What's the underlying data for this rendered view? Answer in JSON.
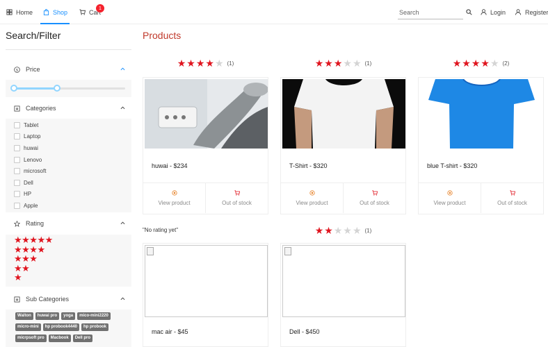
{
  "nav": {
    "home": "Home",
    "shop": "Shop",
    "cart": "Cart",
    "cart_count": "1",
    "search_placeholder": "Search",
    "login": "Login",
    "register": "Register"
  },
  "sidebar": {
    "title": "Search/Filter",
    "price_label": "Price",
    "price_range": {
      "low": 0,
      "high": 0.39
    },
    "categories_label": "Categories",
    "categories": [
      "Tablet",
      "Laptop",
      "huwai",
      "Lenovo",
      "microsoft",
      "Dell",
      "HP",
      "Apple"
    ],
    "rating_label": "Rating",
    "rating_options": [
      "★★★★★",
      "★★★★",
      "★★★",
      "★★",
      "★"
    ],
    "subcategories_label": "Sub Categories",
    "subcategories": [
      "Walton",
      "huwai pro",
      "yoga",
      "mico-mini2220",
      "micro-mini",
      "hp probook4440",
      "hp probook",
      "micrpsoft pro",
      "Macbook",
      "Dell pro"
    ]
  },
  "main": {
    "title": "Products",
    "products": [
      {
        "rating": 4,
        "rating_count": "(1)",
        "title": "huwai - $234",
        "view": "View product",
        "stock": "Out of stock",
        "image": "dental-chair"
      },
      {
        "rating": 3,
        "rating_count": "(1)",
        "title": "T-Shirt - $320",
        "view": "View product",
        "stock": "Out of stock",
        "image": "white-tshirt"
      },
      {
        "rating": 4,
        "rating_count": "(2)",
        "title": "blue T-shirt - $320",
        "view": "View product",
        "stock": "Out of stock",
        "image": "blue-tshirt"
      },
      {
        "no_rating": "\"No rating yet\"",
        "title": "mac air - $45",
        "image": "broken"
      },
      {
        "rating": 2,
        "rating_count": "(1)",
        "title": "Dell - $450",
        "image": "broken"
      }
    ]
  },
  "colors": {
    "accent": "#1890ff",
    "star": "#e0151f",
    "title": "#c0392b",
    "badge": "#f5222d"
  }
}
